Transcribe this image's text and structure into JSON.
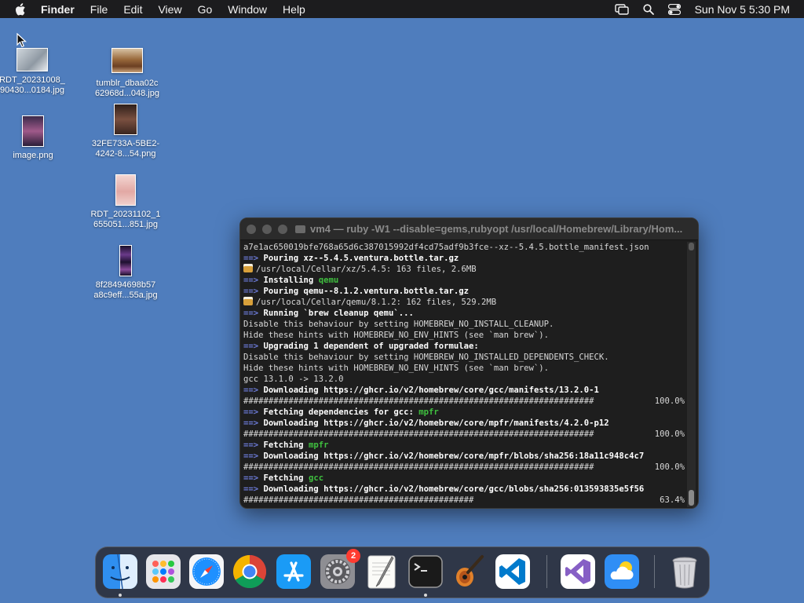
{
  "menubar": {
    "app_name": "Finder",
    "items": [
      "File",
      "Edit",
      "View",
      "Go",
      "Window",
      "Help"
    ],
    "clock": "Sun Nov 5  5:30 PM"
  },
  "desktop": {
    "files": [
      {
        "label_1": "RDT_20231008_",
        "label_2": "90430...0184.jpg"
      },
      {
        "label_1": "tumblr_dbaa02c",
        "label_2": "62968d...048.jpg"
      },
      {
        "label_1": "image.png",
        "label_2": ""
      },
      {
        "label_1": "32FE733A-5BE2-",
        "label_2": "4242-8...54.png"
      },
      {
        "label_1": "RDT_20231102_1",
        "label_2": "655051...851.jpg"
      },
      {
        "label_1": "8f28494698b57",
        "label_2": "a8c9eff...55a.jpg"
      }
    ]
  },
  "terminal": {
    "title": "vm4 — ruby -W1 --disable=gems,rubyopt /usr/local/Homebrew/Library/Hom...",
    "lines": [
      "a7e1ac650019bfe768a65d6c387015992df4cd75adf9b3fce--xz--5.4.5.bottle_manifest.json",
      "Pouring xz--5.4.5.ventura.bottle.tar.gz",
      "/usr/local/Cellar/xz/5.4.5: 163 files, 2.6MB",
      "Installing",
      "qemu",
      "Pouring qemu--8.1.2.ventura.bottle.tar.gz",
      "/usr/local/Cellar/qemu/8.1.2: 162 files, 529.2MB",
      "Running `brew cleanup qemu`...",
      "Disable this behaviour by setting HOMEBREW_NO_INSTALL_CLEANUP.",
      "Hide these hints with HOMEBREW_NO_ENV_HINTS (see `man brew`).",
      "Upgrading 1 dependent of upgraded formulae:",
      "Disable this behaviour by setting HOMEBREW_NO_INSTALLED_DEPENDENTS_CHECK.",
      "Hide these hints with HOMEBREW_NO_ENV_HINTS (see `man brew`).",
      "gcc 13.1.0 -> 13.2.0",
      "Downloading https://ghcr.io/v2/homebrew/core/gcc/manifests/13.2.0-1",
      "######################################################################",
      "100.0%",
      "Fetching dependencies for gcc:",
      "mpfr",
      "Downloading https://ghcr.io/v2/homebrew/core/mpfr/manifests/4.2.0-p12",
      "######################################################################",
      "100.0%",
      "Fetching",
      "mpfr",
      "Downloading https://ghcr.io/v2/homebrew/core/mpfr/blobs/sha256:18a11c948c4c7",
      "######################################################################",
      "100.0%",
      "Fetching",
      "gcc",
      "Downloading https://ghcr.io/v2/homebrew/core/gcc/blobs/sha256:013593835e5f56",
      "##############################################",
      "63.4%"
    ],
    "arrow": "==>",
    "progress_fraction": 0.634
  },
  "dock": {
    "apps": [
      "Finder",
      "Launchpad",
      "Safari",
      "Chrome",
      "App Store",
      "System Settings",
      "TextEdit",
      "Terminal",
      "GarageBand",
      "Visual Studio Code",
      "Visual Studio",
      "Weather",
      "Trash"
    ],
    "settings_badge": "2"
  },
  "colors": {
    "desktop": "#4f7dbd",
    "terminal_arrow": "#6c7bd8",
    "terminal_green": "#3fbf3f"
  }
}
